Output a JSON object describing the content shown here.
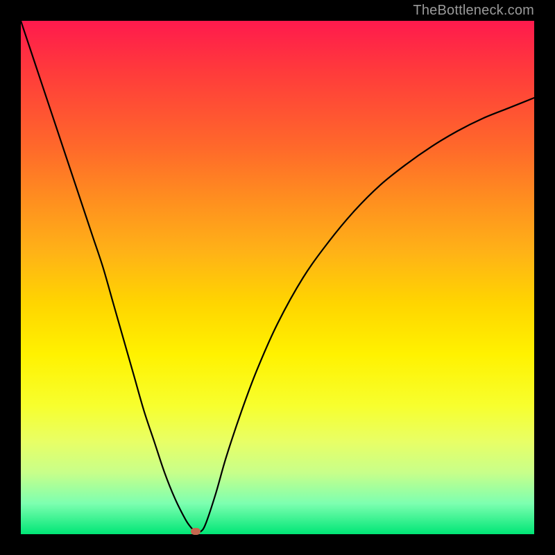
{
  "watermark": "TheBottleneck.com",
  "colors": {
    "marker": "#c5674f",
    "curve": "#000000"
  },
  "chart_data": {
    "type": "line",
    "title": "",
    "xlabel": "",
    "ylabel": "",
    "xlim": [
      0,
      100
    ],
    "ylim": [
      0,
      100
    ],
    "x": [
      0,
      2,
      4,
      6,
      8,
      10,
      12,
      14,
      16,
      18,
      20,
      22,
      24,
      26,
      28,
      30,
      32,
      33,
      34,
      35,
      36,
      38,
      40,
      43,
      46,
      50,
      55,
      60,
      65,
      70,
      75,
      80,
      85,
      90,
      95,
      100
    ],
    "values": [
      100,
      94.0,
      88.0,
      82.0,
      76.0,
      70.0,
      64.0,
      58.0,
      52.0,
      45.0,
      38.0,
      31.0,
      24.0,
      18.0,
      12.0,
      7.0,
      3.0,
      1.5,
      0.5,
      0.5,
      2.0,
      8.0,
      15.0,
      24.0,
      32.0,
      41.0,
      50.0,
      57.0,
      63.0,
      68.0,
      72.0,
      75.5,
      78.5,
      81.0,
      83.0,
      85.0
    ],
    "optimum": {
      "x": 34,
      "y": 0.5
    },
    "annotations": []
  }
}
